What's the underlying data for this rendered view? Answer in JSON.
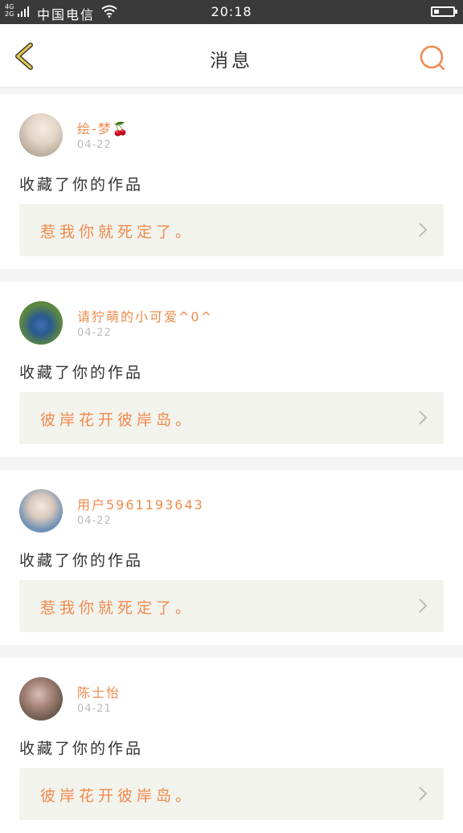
{
  "statusbar": {
    "network": "4G 2G",
    "carrier": "中国电信",
    "time": "20:18"
  },
  "header": {
    "title": "消息",
    "back_icon": "chevron-left-icon",
    "search_icon": "search-icon"
  },
  "colors": {
    "accent": "#f08a4b",
    "back_icon": "#e8c84a",
    "card_box": "#f3f3ee",
    "separator": "#f4f4f4"
  },
  "messages": [
    {
      "username": "绘-梦",
      "emoji": "🍒",
      "date": "04-22",
      "action": "收藏了你的作品",
      "work": "惹我你就死定了。"
    },
    {
      "username": "请狞萌的小可爱^0^",
      "date": "04-22",
      "action": "收藏了你的作品",
      "work": "彼岸花开彼岸岛。"
    },
    {
      "username": "用户5961193643",
      "date": "04-22",
      "action": "收藏了你的作品",
      "work": "惹我你就死定了。"
    },
    {
      "username": "陈士怡",
      "date": "04-21",
      "action": "收藏了你的作品",
      "work": "彼岸花开彼岸岛。"
    }
  ]
}
